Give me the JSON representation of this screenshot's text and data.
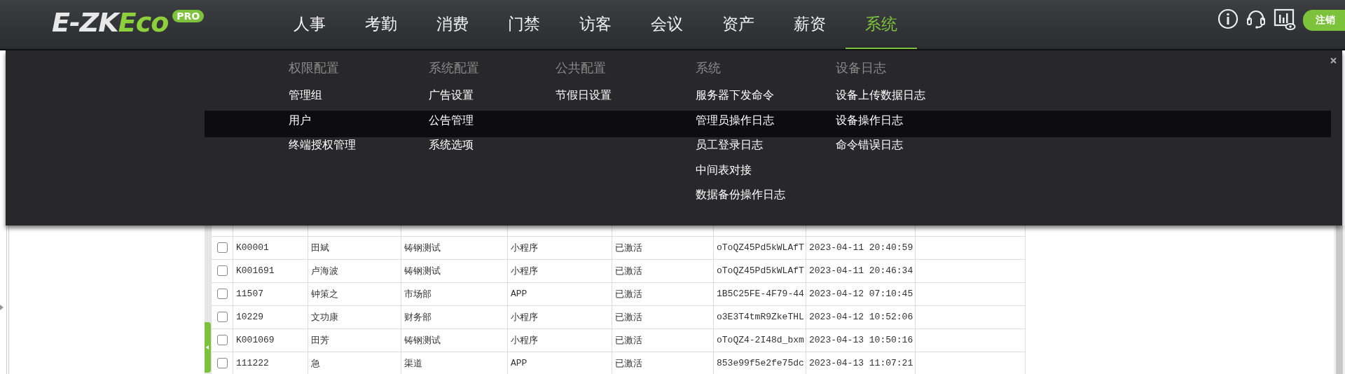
{
  "header": {
    "logo": {
      "main": "E-ZK",
      "accent": "Eco",
      "badge": "PRO"
    },
    "nav": [
      {
        "label": "人事",
        "selected": false
      },
      {
        "label": "考勤",
        "selected": false
      },
      {
        "label": "消费",
        "selected": false
      },
      {
        "label": "门禁",
        "selected": false
      },
      {
        "label": "访客",
        "selected": false
      },
      {
        "label": "会议",
        "selected": false
      },
      {
        "label": "资产",
        "selected": false
      },
      {
        "label": "薪资",
        "selected": false
      },
      {
        "label": "系统",
        "selected": true
      }
    ],
    "logout_button": "注销"
  },
  "table": {
    "rows": [
      {
        "checked": false,
        "cells": [
          "K00001",
          "田斌",
          "铸钢测试",
          "小程序",
          "已激活",
          "oToQZ45Pd5kWLAfT",
          "2023-04-11 20:40:59"
        ]
      },
      {
        "checked": false,
        "cells": [
          "K001691",
          "卢海波",
          "铸钢测试",
          "小程序",
          "已激活",
          "oToQZ45Pd5kWLAfT",
          "2023-04-11 20:46:34"
        ]
      },
      {
        "checked": false,
        "cells": [
          "11507",
          "钟策之",
          "市场部",
          "APP",
          "已激活",
          "1B5C25FE-4F79-44",
          "2023-04-12 07:10:45"
        ]
      },
      {
        "checked": false,
        "cells": [
          "10229",
          "文功康",
          "财务部",
          "小程序",
          "已激活",
          "o3E3T4tmR9ZkeTHL",
          "2023-04-12 10:52:06"
        ]
      },
      {
        "checked": false,
        "cells": [
          "K001069",
          "田芳",
          "铸钢测试",
          "小程序",
          "已激活",
          "oToQZ4-2I48d_bxm",
          "2023-04-13 10:50:16"
        ]
      },
      {
        "checked": false,
        "cells": [
          "111222",
          "急",
          "渠道",
          "APP",
          "已激活",
          "853e99f5e2fe75dc",
          "2023-04-13 11:07:21"
        ]
      }
    ]
  },
  "mega_menu": {
    "groups": [
      {
        "title": "权限配置",
        "items": [
          "管理组",
          "用户",
          "终端授权管理"
        ]
      },
      {
        "title": "系统配置",
        "items": [
          "广告设置",
          "公告管理",
          "系统选项"
        ]
      },
      {
        "title": "公共配置",
        "items": [
          "节假日设置"
        ]
      },
      {
        "title": "系统",
        "items": [
          "服务器下发命令",
          "管理员操作日志",
          "员工登录日志",
          "中间表对接",
          "数据备份操作日志"
        ]
      },
      {
        "title": "设备日志",
        "items": [
          "设备上传数据日志",
          "设备操作日志",
          "命令错误日志"
        ]
      }
    ]
  }
}
